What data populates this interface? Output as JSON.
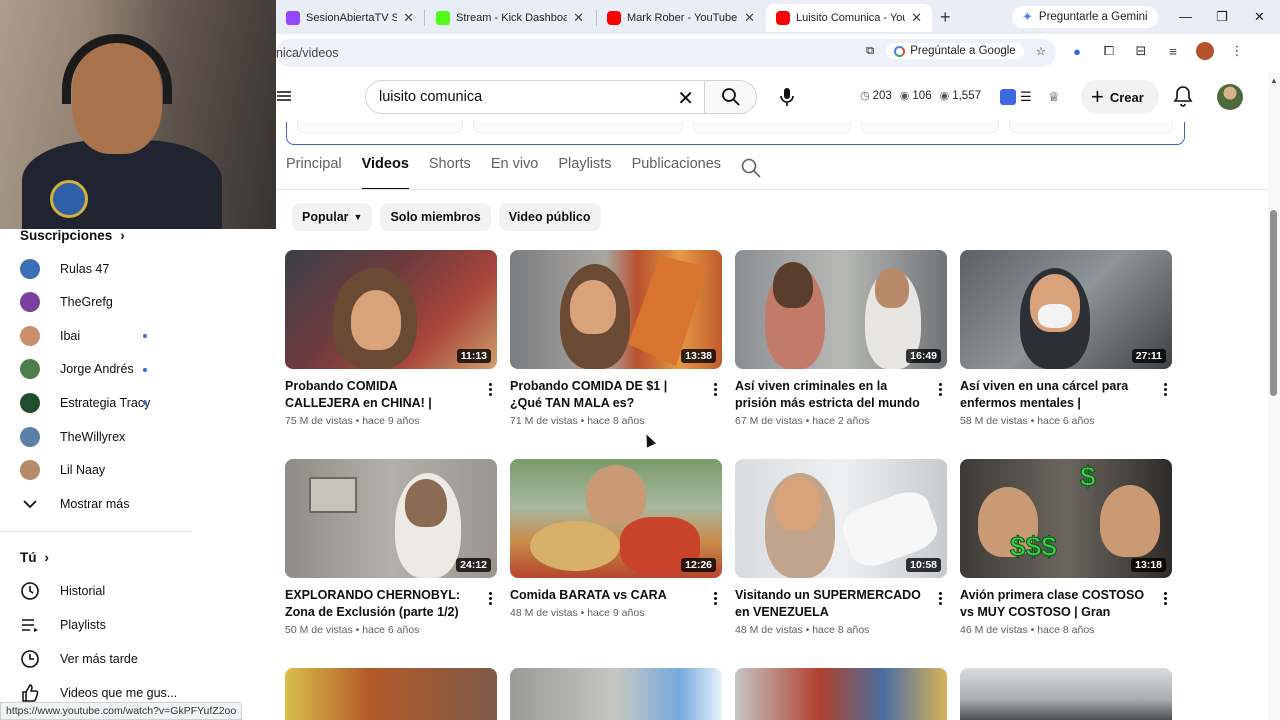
{
  "browser": {
    "tabs": [
      {
        "title": "SesionAbiertaTV Stream",
        "favicon_color": "#9147ff"
      },
      {
        "title": "Stream - Kick Dashboard",
        "favicon_color": "#53fc18"
      },
      {
        "title": "Mark Rober - YouTube",
        "favicon_color": "#ff0000"
      },
      {
        "title": "Luisito Comunica - YouTube",
        "favicon_color": "#ff0000"
      }
    ],
    "gemini_button": "Preguntarle a Gemini",
    "url": "nica/videos",
    "ask_google": "Pregúntale a Google",
    "status_url": "https://www.youtube.com/watch?v=GkPFYufZ2oo"
  },
  "header": {
    "search_value": "luisito comunica",
    "stats": {
      "a": "203",
      "b": "106",
      "c": "1,557"
    },
    "create_label": "Crear"
  },
  "channel_tabs": [
    "Principal",
    "Videos",
    "Shorts",
    "En vivo",
    "Playlists",
    "Publicaciones"
  ],
  "active_tab": "Videos",
  "chips": [
    "Popular",
    "Solo miembros",
    "Video público"
  ],
  "sidebar": {
    "subscriptions_title": "Suscripciones",
    "subscriptions": [
      {
        "name": "Rulas 47",
        "color": "#3b6fb6",
        "new": false
      },
      {
        "name": "TheGrefg",
        "color": "#7b3fa0",
        "new": false
      },
      {
        "name": "Ibai",
        "color": "#c98e6a",
        "new": true
      },
      {
        "name": "Jorge Andrés",
        "color": "#4d7d4a",
        "new": true
      },
      {
        "name": "Estrategia Tracy",
        "color": "#1f4d2e",
        "new": true
      },
      {
        "name": "TheWillyrex",
        "color": "#5c7fa8",
        "new": false
      },
      {
        "name": "Lil Naay",
        "color": "#b58b6a",
        "new": false
      }
    ],
    "show_more": "Mostrar más",
    "you_title": "Tú",
    "you_items": [
      "Historial",
      "Playlists",
      "Ver más tarde",
      "Videos que me gus..."
    ]
  },
  "videos": [
    {
      "title": "Probando COMIDA CALLEJERA en CHINA! | ¿Realmente comen perro?",
      "duration": "11:13",
      "views": "75 M de vistas",
      "age": "hace 9 años"
    },
    {
      "title": "Probando COMIDA DE $1 | ¿Qué TAN MALA es?",
      "duration": "13:38",
      "views": "71 M de vistas",
      "age": "hace 8 años"
    },
    {
      "title": "Así viven criminales en la prisión más estricta del mundo | El...",
      "duration": "16:49",
      "views": "67 M de vistas",
      "age": "hace 2 años"
    },
    {
      "title": "Así viven en una cárcel para enfermos mentales | Topochico,...",
      "duration": "27:11",
      "views": "58 M de vistas",
      "age": "hace 6 años"
    },
    {
      "title": "EXPLORANDO CHERNOBYL: Zona de Exclusión (parte 1/2)",
      "duration": "24:12",
      "views": "50 M de vistas",
      "age": "hace 6 años"
    },
    {
      "title": "Comida BARATA vs CARA",
      "duration": "12:26",
      "views": "48 M de vistas",
      "age": "hace 9 años"
    },
    {
      "title": "Visitando un SUPERMERCADO en VENEZUELA",
      "duration": "10:58",
      "views": "48 M de vistas",
      "age": "hace 8 años"
    },
    {
      "title": "Avión primera clase COSTOSO vs MUY COSTOSO | Gran diferencia!",
      "duration": "13:18",
      "views": "46 M de vistas",
      "age": "hace 8 años"
    }
  ],
  "colors": {
    "accent_blue": "#3e6ae1",
    "yt_red": "#ff0000"
  }
}
